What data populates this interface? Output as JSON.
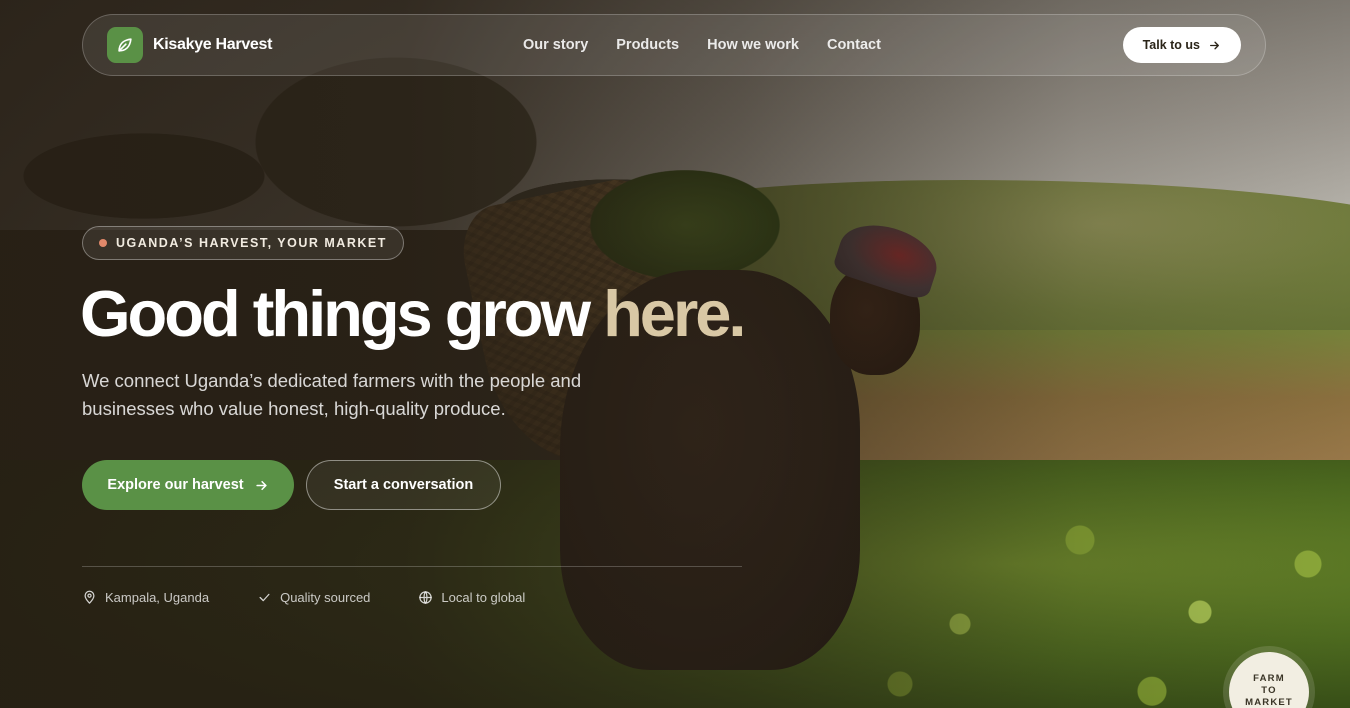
{
  "brand": {
    "name": "Kisakye Harvest",
    "icon": "leaf-icon",
    "color": "#5a9146"
  },
  "nav": {
    "links": [
      "Our story",
      "Products",
      "How we work",
      "Contact"
    ],
    "cta_label": "Talk to us"
  },
  "hero": {
    "eyebrow": "UGANDA’S HARVEST, YOUR MARKET",
    "headline_main": "Good things grow",
    "headline_accent": "here",
    "headline_end": ".",
    "subtitle": "We connect Uganda’s dedicated farmers with the people and businesses who value honest, high-quality produce.",
    "primary_button": "Explore our harvest",
    "secondary_button": "Start a conversation"
  },
  "features": [
    {
      "icon": "map-pin-icon",
      "label": "Kampala, Uganda"
    },
    {
      "icon": "check-icon",
      "label": "Quality sourced"
    },
    {
      "icon": "globe-icon",
      "label": "Local to global"
    }
  ],
  "badge": {
    "lines": [
      "FARM",
      "TO",
      "MARKET"
    ]
  },
  "colors": {
    "accent_green": "#5a9146",
    "accent_sand": "#d9c8a5",
    "dot": "#e1886a"
  }
}
